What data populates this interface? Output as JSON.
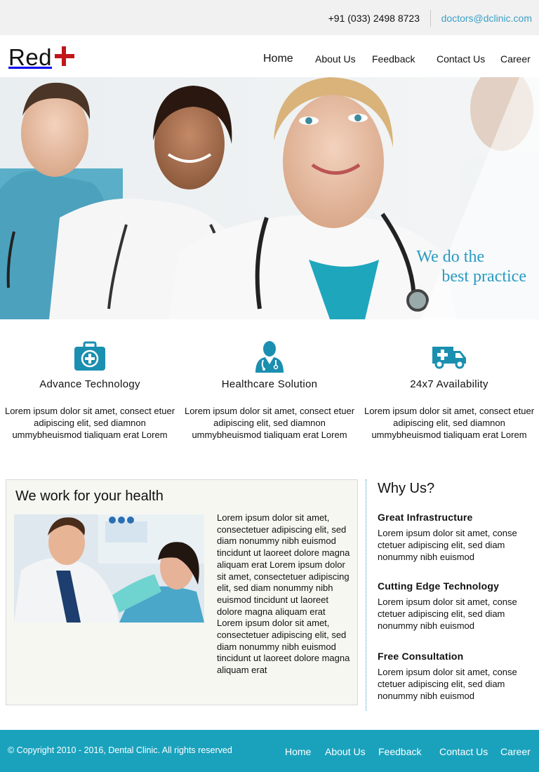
{
  "topbar": {
    "phone": "+91 (033) 2498 8723",
    "email": "doctors@dclinic.com"
  },
  "brand": {
    "name": "Red",
    "accent_color": "#c0161c"
  },
  "nav": {
    "items": [
      {
        "label": "Home",
        "active": true
      },
      {
        "label": "About Us"
      },
      {
        "label": "Feedback"
      },
      {
        "label": "Contact Us"
      },
      {
        "label": "Career"
      }
    ]
  },
  "hero": {
    "tagline_line1": "We do the",
    "tagline_line2": "best practice"
  },
  "features": [
    {
      "icon": "medical-kit-icon",
      "title": "Advance Technology",
      "text": "Lorem ipsum dolor sit amet, consect etuer adipiscing elit, sed diamnon ummybheuismod tialiquam erat Lorem"
    },
    {
      "icon": "doctor-icon",
      "title": "Healthcare Solution",
      "text": "Lorem ipsum dolor sit amet, consect etuer adipiscing elit, sed diamnon ummybheuismod tialiquam erat Lorem"
    },
    {
      "icon": "ambulance-icon",
      "title": "24x7 Availability",
      "text": "Lorem ipsum dolor sit amet, consect etuer adipiscing elit, sed diamnon ummybheuismod tialiquam erat Lorem"
    }
  ],
  "work": {
    "title": "We work for your health",
    "text": "Lorem ipsum dolor sit amet, consectetuer adipiscing elit, sed diam nonummy nibh euismod tincidunt ut laoreet dolore magna aliquam erat Lorem ipsum dolor sit amet, consectetuer adipiscing elit, sed diam nonummy nibh euismod tincidunt ut laoreet dolore magna aliquam erat Lorem ipsum dolor sit amet, consectetuer adipiscing elit, sed diam nonummy nibh euismod tincidunt ut laoreet dolore magna aliquam erat"
  },
  "why": {
    "title": "Why Us?",
    "items": [
      {
        "title": "Great Infrastructure",
        "text": "Lorem ipsum dolor sit amet, conse ctetuer adipiscing elit, sed diam nonummy nibh euismod"
      },
      {
        "title": "Cutting Edge Technology",
        "text": "Lorem ipsum dolor sit amet, conse ctetuer adipiscing elit, sed diam nonummy nibh euismod"
      },
      {
        "title": "Free Consultation",
        "text": "Lorem ipsum dolor sit amet, conse ctetuer adipiscing elit, sed diam nonummy nibh euismod"
      }
    ]
  },
  "footer": {
    "copyright": "© Copyright 2010 - 2016, Dental Clinic. All rights reserved",
    "links": [
      "Home",
      "About Us",
      "Feedback",
      "Contact Us",
      "Career"
    ]
  },
  "colors": {
    "accent": "#1aa2bd",
    "tagline": "#2a9ac4",
    "icon": "#1a8fb0"
  }
}
